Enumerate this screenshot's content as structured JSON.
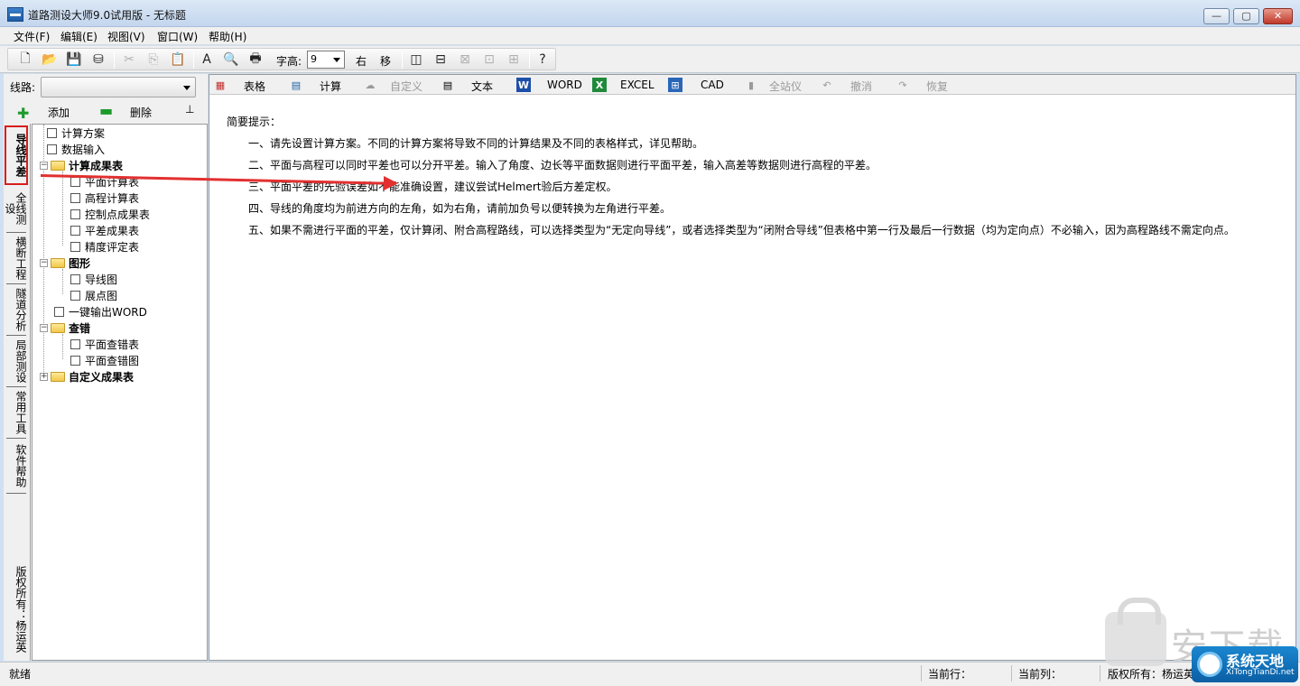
{
  "window": {
    "title": "道路测设大师9.0试用版 - 无标题",
    "min_label": "—",
    "max_label": "▢",
    "close_label": "✕"
  },
  "menu": [
    "文件(F)",
    "编辑(E)",
    "视图(V)",
    "窗口(W)",
    "帮助(H)"
  ],
  "toolbar": {
    "font_size_label": "字高:",
    "font_size_value": "9",
    "right_label": "右",
    "move_label": "移"
  },
  "left": {
    "route_label": "线路:",
    "add_label": "添加",
    "delete_label": "删除",
    "vertical_tabs": [
      "导线平差",
      "全线测设",
      "横断工程",
      "隧道分析",
      "局部测设",
      "常用工具",
      "软件帮助"
    ],
    "copyright_vertical": "版权所有：杨运英",
    "tree": [
      {
        "label": "计算方案"
      },
      {
        "label": "数据输入"
      },
      {
        "label": "计算成果表"
      },
      {
        "label": "平面计算表"
      },
      {
        "label": "高程计算表"
      },
      {
        "label": "控制点成果表"
      },
      {
        "label": "平差成果表"
      },
      {
        "label": "精度评定表"
      },
      {
        "label": "图形"
      },
      {
        "label": "导线图"
      },
      {
        "label": "展点图"
      },
      {
        "label": "一键输出WORD"
      },
      {
        "label": "查错"
      },
      {
        "label": "平面查错表"
      },
      {
        "label": "平面查错图"
      },
      {
        "label": "自定义成果表"
      }
    ]
  },
  "main_toolbar": {
    "table": "表格",
    "calc": "计算",
    "custom": "自定义",
    "text": "文本",
    "word": "WORD",
    "excel": "EXCEL",
    "cad": "CAD",
    "total_station": "全站仪",
    "undo": "撤消",
    "redo": "恢复"
  },
  "hints": {
    "title": "简要提示：",
    "lines": [
      "一、请先设置计算方案。不同的计算方案将导致不同的计算结果及不同的表格样式，详见帮助。",
      "二、平面与高程可以同时平差也可以分开平差。输入了角度、边长等平面数据则进行平面平差，输入高差等数据则进行高程的平差。",
      "三、平面平差的先验误差如不能准确设置，建议尝试Helmert验后方差定权。",
      "四、导线的角度均为前进方向的左角，如为右角，请前加负号以便转换为左角进行平差。",
      "五、如果不需进行平面的平差，仅计算闭、附合高程路线，可以选择类型为“无定向导线”，或者选择类型为“闭附合导线”但表格中第一行及最后一行数据（均为定向点）不必输入，因为高程路线不需定向点。"
    ]
  },
  "status": {
    "ready": "就绪",
    "current_row": "当前行：",
    "current_col": "当前列：",
    "copyright": "版权所有：杨运英"
  },
  "watermark": {
    "text": "安下载",
    "badge_title": "系统天地",
    "badge_url": "XiTongTianDi.net"
  },
  "colors": {
    "highlight_red": "#d81e1e",
    "arrow_red": "#e23030",
    "title_bg": "#c3d6ee"
  }
}
